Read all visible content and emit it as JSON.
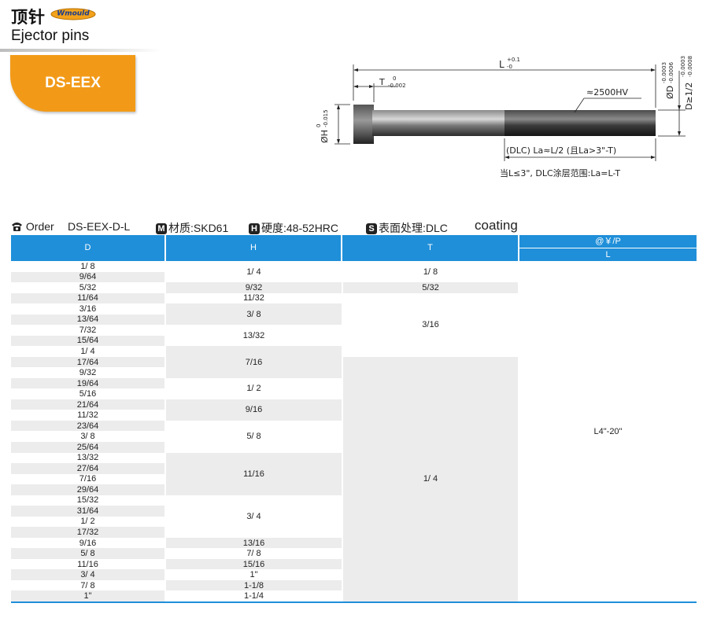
{
  "header": {
    "title_cn": "顶针",
    "brand": "Wmould",
    "title_en": "Ejector pins",
    "model_tag": "DS-EEX"
  },
  "drawing": {
    "length": "L",
    "length_tol_upper": "+0.1",
    "length_tol_lower": "-0",
    "head_thickness": "T",
    "head_thickness_tol_upper": "0",
    "head_thickness_tol_lower": "-0.002",
    "head_dia": "ØH",
    "head_dia_tol_upper": "0",
    "head_dia_tol_lower": "-0.015",
    "pin_dia": "ØD",
    "pin_dia_tol_upper": "-0.0003",
    "pin_dia_tol_lower": "-0.0006",
    "pin_dia_half": "D≥1/2",
    "pin_dia_half_tol_upper": "-0.0003",
    "pin_dia_half_tol_lower": "-0.0008",
    "hardness": "≈2500HV",
    "coating_zone": "(DLC) La≈L/2 (且La>3\"-T)",
    "coating_note": "当L≤3\", DLC涂层范围:La=L-T"
  },
  "order": {
    "order_label": "Order",
    "order_code": "DS-EEX-D-L",
    "material_badge": "M",
    "material": "材质:SKD61",
    "hardness_badge": "H",
    "hardness": "硬度:48-52HRC",
    "surface_badge": "S",
    "surface": "表面处理:DLC",
    "coating": "coating"
  },
  "table": {
    "headers": {
      "d": "D",
      "h": "H",
      "t": "T",
      "price": "@￥/P",
      "l": "L"
    },
    "d_values": [
      "1/ 8",
      "9/64",
      "5/32",
      "11/64",
      "3/16",
      "13/64",
      "7/32",
      "15/64",
      "1/ 4",
      "17/64",
      "9/32",
      "19/64",
      "5/16",
      "21/64",
      "11/32",
      "23/64",
      "3/ 8",
      "25/64",
      "13/32",
      "27/64",
      "7/16",
      "29/64",
      "15/32",
      "31/64",
      "1/ 2",
      "17/32",
      "9/16",
      "5/ 8",
      "11/16",
      "3/ 4",
      "7/ 8",
      "1\""
    ],
    "h_groups": [
      {
        "value": "1/ 4",
        "start": 0,
        "span": 2
      },
      {
        "value": "9/32",
        "start": 2,
        "span": 1
      },
      {
        "value": "11/32",
        "start": 3,
        "span": 1
      },
      {
        "value": "3/ 8",
        "start": 4,
        "span": 2
      },
      {
        "value": "13/32",
        "start": 6,
        "span": 2
      },
      {
        "value": "7/16",
        "start": 8,
        "span": 3
      },
      {
        "value": "1/ 2",
        "start": 11,
        "span": 2
      },
      {
        "value": "9/16",
        "start": 13,
        "span": 2
      },
      {
        "value": "5/ 8",
        "start": 15,
        "span": 3
      },
      {
        "value": "11/16",
        "start": 18,
        "span": 4
      },
      {
        "value": "3/ 4",
        "start": 22,
        "span": 4
      },
      {
        "value": "13/16",
        "start": 26,
        "span": 1
      },
      {
        "value": "7/ 8",
        "start": 27,
        "span": 1
      },
      {
        "value": "15/16",
        "start": 28,
        "span": 1
      },
      {
        "value": "1\"",
        "start": 29,
        "span": 1
      },
      {
        "value": "1-1/8",
        "start": 30,
        "span": 1
      },
      {
        "value": "1-1/4",
        "start": 31,
        "span": 1
      }
    ],
    "t_groups": [
      {
        "value": "1/ 8",
        "start": 0,
        "span": 2
      },
      {
        "value": "5/32",
        "start": 2,
        "span": 1
      },
      {
        "value": "3/16",
        "start": 3,
        "span": 6
      },
      {
        "value": "1/ 4",
        "start": 9,
        "span": 23
      }
    ],
    "l_value": "L4\"-20\""
  }
}
